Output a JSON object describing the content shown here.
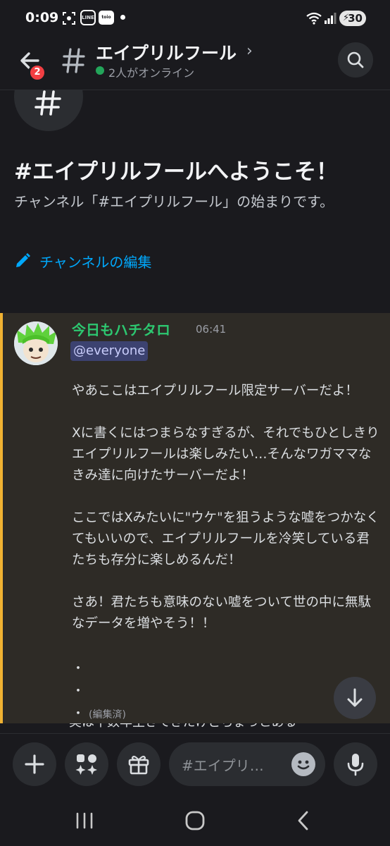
{
  "status_bar": {
    "time": "0:09",
    "line_icon_label": "LINE",
    "app_icon_label": "toio",
    "battery": "30",
    "icons": [
      "screenshot-icon",
      "line-icon",
      "app-icon",
      "wifi-icon",
      "signal-icon",
      "battery-icon"
    ]
  },
  "header": {
    "badge_count": "2",
    "title": "エイプリルフール",
    "online_text": "2人がオンライン",
    "online_color": "#23a55a"
  },
  "welcome": {
    "title": "#エイプリルフールへようこそ！",
    "subtitle": "チャンネル「#エイプリルフール」の始まりです。",
    "edit_label": "チャンネルの編集",
    "link_color": "#00a8fc"
  },
  "message": {
    "author": "今日もハチタロ",
    "author_color": "#2dc770",
    "time": "06:41",
    "mention": "@everyone",
    "paragraphs": [
      "やあここはエイプリルフール限定サーバーだよ！",
      "Xに書くにはつまらなすぎるが、それでもひとしきりエイプリルフールは楽しみたい…そんなワガママなきみ達に向けたサーバーだよ！",
      "ここではXみたいに\"ウケ\"を狙うような嘘をつかなくてもいいので、エイプリルフールを冷笑している君たちも存分に楽しめるんだ！",
      "さあ！君たちも意味のない嘘をついて世の中に無駄なデータを増やそう！！"
    ],
    "bullets": [
      "・",
      "・",
      "・"
    ],
    "edited_label": "(編集済)",
    "next_line_partial": "実は十数年生きてきたけどちょっとある",
    "highlight_color": "#f0b232"
  },
  "composer": {
    "placeholder": "#エイプリ…"
  },
  "navbar": {
    "items": [
      "recent-apps",
      "home",
      "back"
    ]
  }
}
